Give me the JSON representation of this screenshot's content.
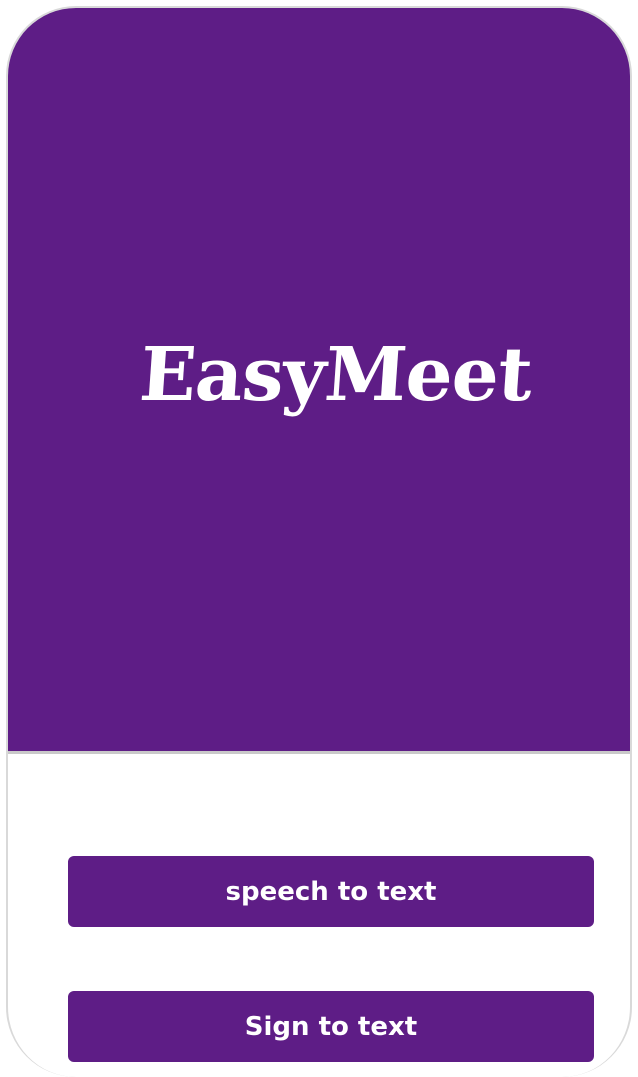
{
  "app": {
    "logo_text": "EasyMeet"
  },
  "actions": {
    "speech_to_text_label": "speech to text",
    "sign_to_text_label": "Sign to text"
  },
  "colors": {
    "brand_purple": "#5e1d86",
    "background": "#ffffff",
    "text_on_brand": "#ffffff"
  }
}
